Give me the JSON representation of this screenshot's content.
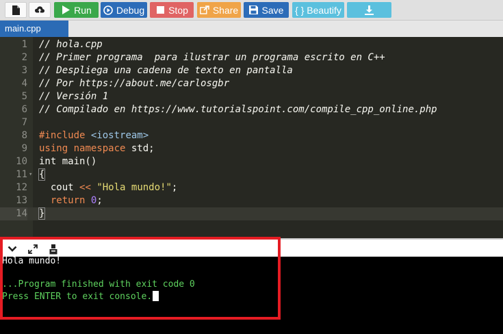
{
  "toolbar": {
    "run_label": "Run",
    "debug_label": "Debug",
    "stop_label": "Stop",
    "share_label": "Share",
    "save_label": "Save",
    "beautify_label": "{ } Beautify"
  },
  "tabs": [
    {
      "label": "main.cpp"
    }
  ],
  "editor": {
    "line_numbers": [
      "1",
      "2",
      "3",
      "4",
      "5",
      "6",
      "7",
      "8",
      "9",
      "10",
      "11",
      "12",
      "13",
      "14"
    ],
    "comments": [
      "// hola.cpp",
      "// Primer programa  para ilustrar un programa escrito en C++",
      "// Despliega una cadena de texto en pantalla",
      "// Por https://about.me/carlosgbr",
      "// Versión 1",
      "// Compilado en https://www.tutorialspoint.com/compile_cpp_online.php"
    ],
    "include_kw": "#include",
    "include_file": "<iostream>",
    "using_kw": "using",
    "namespace_kw": "namespace",
    "namespace_rest": " std;",
    "main_sig": "int main()",
    "open_brace": "{",
    "cout_ident": "  cout ",
    "cout_op": "<<",
    "cout_space": " ",
    "cout_string": "\"Hola mundo!\"",
    "cout_end": ";",
    "return_kw": "  return",
    "return_space": " ",
    "return_val": "0",
    "return_end": ";",
    "close_brace": "}"
  },
  "console": {
    "output": "Hola mundo!",
    "finished": "...Program finished with exit code 0",
    "press_enter": "Press ENTER to exit console."
  },
  "colors": {
    "run": "#3aa84a",
    "debug": "#2c6cb8",
    "stop": "#e06464",
    "share": "#f0a448",
    "beautify": "#5bc0de",
    "highlight": "#e51c23"
  }
}
